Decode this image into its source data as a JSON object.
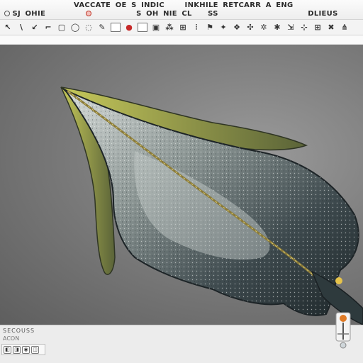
{
  "menubar": {
    "row1": [
      "VACCATE",
      "OE",
      "S",
      "INDIC",
      "INKHILE",
      "RETCARR",
      "A",
      "ENG"
    ],
    "row2": [
      "SJ",
      "OHIE",
      "S",
      "OH",
      "NIE",
      "CL",
      "SS",
      "DLIEUS"
    ]
  },
  "toolbar": {
    "buttons": [
      "↖",
      "\\",
      "↙",
      "⌐",
      "▢",
      "◯",
      "◌",
      "✎",
      "▭",
      "●",
      "☐",
      "▣",
      "⁂",
      "⊞",
      "⫶",
      "⚑",
      "✦",
      "❖",
      "✣",
      "✲",
      "✱",
      "⇲",
      "⊹",
      "⊞",
      "✖",
      "⋔"
    ]
  },
  "viewport": {
    "object": "leaf-shaped 3D model",
    "colors": {
      "background_light": "#9a9a9a",
      "background_dark": "#5e5e5e",
      "leaf_body": "#3f4a4e",
      "leaf_highlight": "#c9d0cf",
      "leaf_edge": "#a7a93a",
      "midrib": "#8a7a3a"
    }
  },
  "statusbar": {
    "line1": "SECOUSS",
    "line2": "ACON",
    "panel_buttons": [
      "◧",
      "◨",
      "◉",
      "◫"
    ]
  }
}
